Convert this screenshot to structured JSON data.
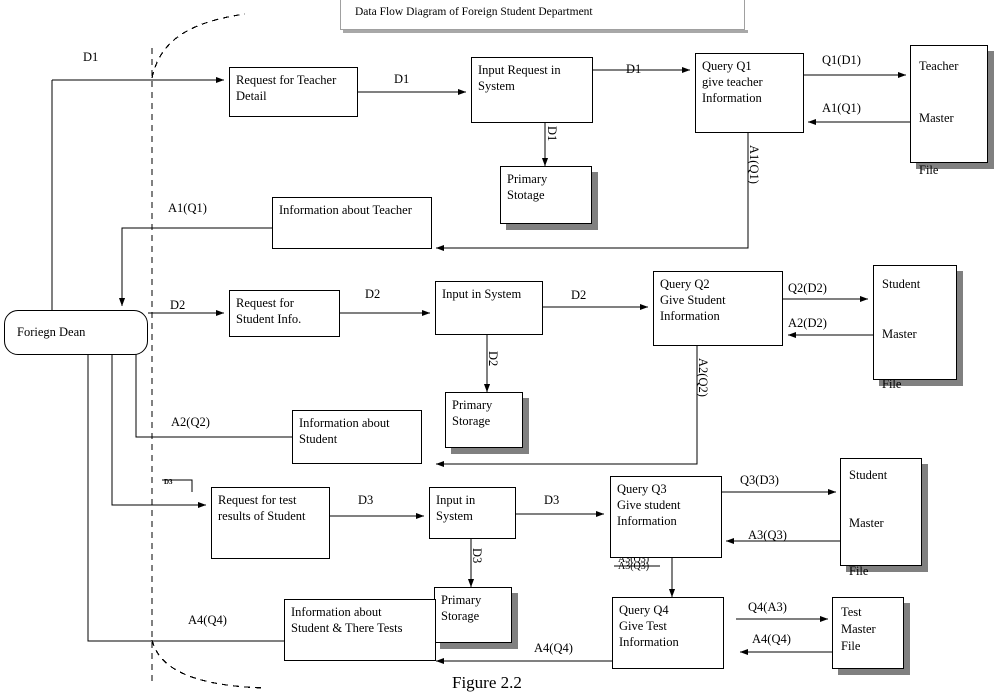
{
  "figure": {
    "title": "Data Flow Diagram of Foreign Student Department",
    "caption": "Figure 2.2"
  },
  "entities": {
    "foreign_dean": "Foriegn Dean",
    "teacher_master_file": "Teacher\n\nMaster\n\nFile",
    "student_master_file_1": "Student\n\nMaster\n\nFile",
    "student_master_file_2": "Student\n\nMaster\n\nFile",
    "test_master_file": "Test\nMaster\nFile"
  },
  "processes": {
    "request_teacher_detail": "Request for Teacher\nDetail",
    "input_request_system": "Input Request in\nSystem",
    "query_q1": "Query Q1\ngive teacher\nInformation",
    "info_about_teacher": "Information about Teacher",
    "request_student_info": "Request for\nStudent Info.",
    "input_in_system_2": "Input in System",
    "query_q2": "Query Q2\nGive Student\nInformation",
    "info_about_student": "Information about\nStudent",
    "request_test_results": "Request for test\nresults of Student",
    "input_in_system_3": "Input in\nSystem",
    "query_q3": "Query Q3\nGive student\nInformation",
    "info_student_tests": "Information about\nStudent & There Tests",
    "query_q4": "Query Q4\nGive Test\nInformation"
  },
  "stores": {
    "primary_storage_1": "Primary\nStotage",
    "primary_storage_2": "Primary\nStorage",
    "primary_storage_3": "Primary\nStorage",
    "primary_storage_4": "Primary\nStorage"
  },
  "flow_labels": {
    "d1_dean_to_request": "D1",
    "d1_request_to_input": "D1",
    "d1_input_to_q1": "D1",
    "d1_input_to_storage": "D1",
    "q1_d1": "Q1(D1)",
    "a1_q1_file": "A1(Q1)",
    "a1_q1_vertical": "A1(Q1)",
    "a1_q1_to_dean": "A1(Q1)",
    "d2_dean_to_request": "D2",
    "d2_request_to_input": "D2",
    "d2_input_to_q2": "D2",
    "d2_input_to_storage": "D2",
    "q2_d2": "Q2(D2)",
    "a2_d2": "A2(D2)",
    "a2_q2_vertical": "A2(Q2)",
    "a2_q2_to_dean": "A2(Q2)",
    "d3_dean_small": "D3",
    "d3_request_to_input": "D3",
    "d3_input_to_q3": "D3",
    "d3_input_to_storage": "D3",
    "q3_d3": "Q3(D3)",
    "a3_q3_file": "A3(Q3)",
    "a3_q3_vertical_top": "A3(Q3)",
    "a3_q3_vertical_bottom": "A3(Q3)",
    "q4_a3": "Q4(A3)",
    "a4_q4_file": "A4(Q4)",
    "a4_q4_to_info": "A4(Q4)",
    "a4_q4_to_dean": "A4(Q4)"
  },
  "colors": {
    "line": "#000000",
    "shadow": "#808080",
    "background": "#ffffff"
  }
}
